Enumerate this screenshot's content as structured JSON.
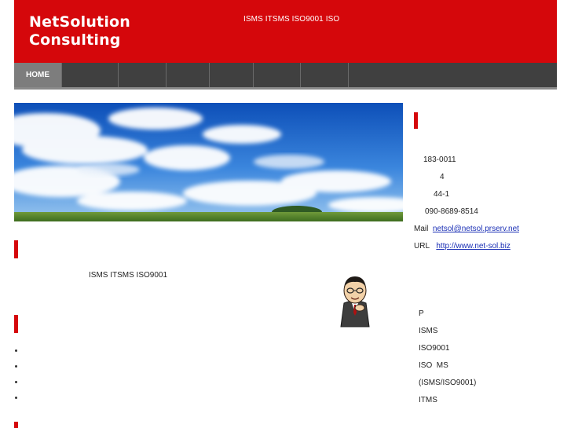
{
  "header": {
    "brand_line1": "NetSolution",
    "brand_line2": "Consulting",
    "tagline": "ISMS ITSMS ISO9001  ISO"
  },
  "nav": {
    "items": [
      {
        "label": "HOME",
        "active": true
      },
      {
        "label": ""
      },
      {
        "label": ""
      },
      {
        "label": ""
      },
      {
        "label": ""
      },
      {
        "label": ""
      },
      {
        "label": ""
      },
      {
        "label": ""
      }
    ]
  },
  "main": {
    "intro_text": "ISMS ITSMS ISO9001",
    "bullets_count_note": ""
  },
  "contact": {
    "postal": "183-0011",
    "line2": "4",
    "line3": "44-1",
    "phone": "090-8689-8514",
    "mail_label": "Mail",
    "mail": "netsol@netsol.prserv.net",
    "url_label": "URL",
    "url": "http://www.net-sol.biz"
  },
  "services": {
    "items": [
      "P",
      "ISMS",
      "ISO9001",
      "ISO  MS",
      "(ISMS/ISO9001)",
      "ITMS"
    ]
  },
  "colors": {
    "brand_red": "#d5070b",
    "nav_bg": "#404040",
    "nav_active": "#7d7d7d",
    "link": "#1a2fb5"
  }
}
